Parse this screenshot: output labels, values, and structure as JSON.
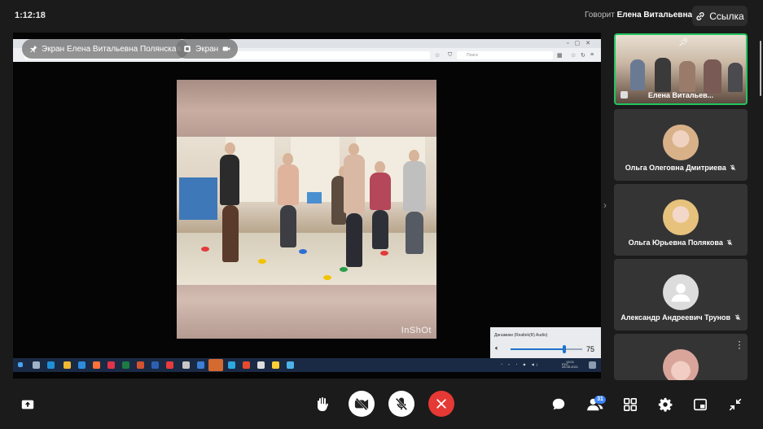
{
  "header": {
    "timer": "1:12:18",
    "speaking_label": "Говорит",
    "speaker_name": "Елена Витальевна П.",
    "link_label": "Ссылка"
  },
  "stage": {
    "screen_pill": "Экран Елена Витальевна Полянская",
    "screen_pill_2": "Экран",
    "browser_search_placeholder": "Поиск",
    "video_watermark": "InShOt",
    "volume": {
      "device_label": "Динамики (Realtek(R) Audio)",
      "level": 75,
      "level_text": "75"
    },
    "taskbar": {
      "lang": "РУС",
      "time": "13:01",
      "date": "26.05.2021"
    }
  },
  "participants": [
    {
      "name": "Елена Витальев...",
      "pinned": true,
      "speaking": true
    },
    {
      "name": "Ольга Олеговна Дмитриева",
      "muted": true
    },
    {
      "name": "Ольга Юрьевна Полякова",
      "muted": true
    },
    {
      "name": "Александр Андреевич Трунов",
      "muted": true
    },
    {
      "name": "",
      "muted": false
    }
  ],
  "toolbar": {
    "participants_count": "31"
  },
  "colors": {
    "background": "#1b1b1b",
    "active_border": "#22c55e",
    "leave_button": "#e53935",
    "mute_button": "#ffffff",
    "badge": "#3b82f6"
  }
}
